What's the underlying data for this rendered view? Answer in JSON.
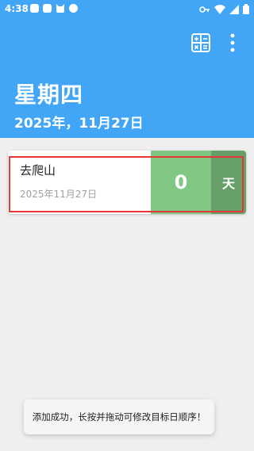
{
  "status_bar": {
    "time": "4:38"
  },
  "header": {
    "day_of_week": "星期四",
    "full_date": "2025年，11月27日",
    "icons": [
      "calculator-icon",
      "more-vert-icon"
    ]
  },
  "events": [
    {
      "title": "去爬山",
      "date": "2025年11月27日",
      "count": "0",
      "unit": "天"
    }
  ],
  "toast": {
    "message": "添加成功，长按并拖动可修改目标日顺序！"
  },
  "colors": {
    "primary": "#42a5f5",
    "count_bg": "#81c784",
    "unit_bg": "#66a068",
    "highlight": "#e53935"
  }
}
